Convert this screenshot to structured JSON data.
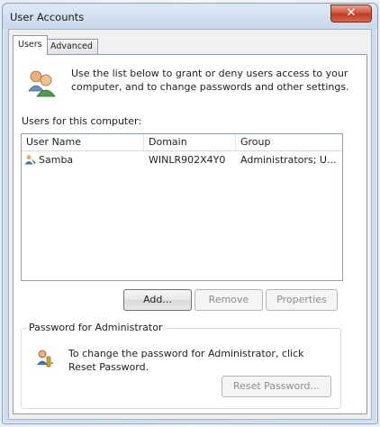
{
  "window": {
    "title": "User Accounts",
    "close_glyph": "✕"
  },
  "tabs": [
    {
      "label": "Users",
      "active": true
    },
    {
      "label": "Advanced",
      "active": false
    }
  ],
  "intro": {
    "icon": "users-icon",
    "text": "Use the list below to grant or deny users access to your computer, and to change passwords and other settings."
  },
  "users_label": "Users for this computer:",
  "table": {
    "columns": [
      "User Name",
      "Domain",
      "Group"
    ],
    "rows": [
      {
        "icon": "user-icon",
        "name": "Samba",
        "domain": "WINLR902X4Y0",
        "group": "Administrators; U..."
      }
    ]
  },
  "buttons": {
    "add": "Add...",
    "remove": "Remove",
    "properties": "Properties"
  },
  "password": {
    "group_title": "Password for Administrator",
    "icon": "key-icon",
    "text": "To change the password for Administrator, click Reset Password.",
    "reset_button": "Reset Password..."
  },
  "colors": {
    "close_button": "#c03c24",
    "titlebar": "#cfdced"
  }
}
